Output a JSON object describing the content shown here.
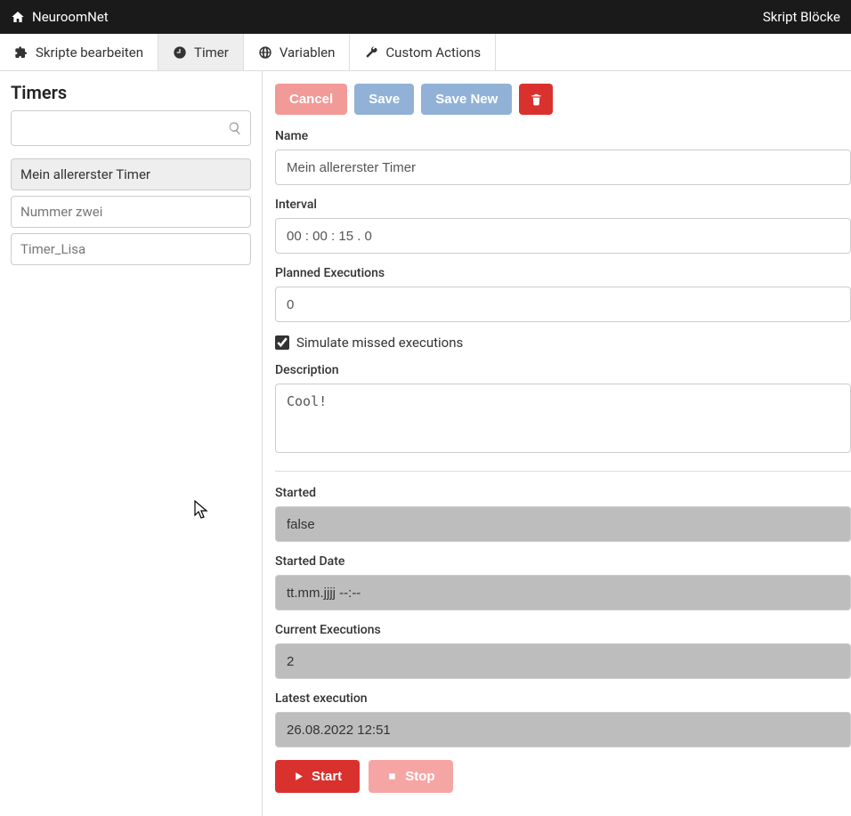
{
  "topbar": {
    "brand": "NeuroomNet",
    "right": "Skript Blöcke"
  },
  "tabs": [
    {
      "label": "Skripte bearbeiten",
      "icon": "puzzle"
    },
    {
      "label": "Timer",
      "icon": "clock",
      "active": true
    },
    {
      "label": "Variablen",
      "icon": "globe"
    },
    {
      "label": "Custom Actions",
      "icon": "wrench"
    }
  ],
  "sidebar": {
    "heading": "Timers",
    "search_value": "",
    "items": [
      {
        "label": "Mein allererster Timer",
        "active": true
      },
      {
        "label": "Nummer zwei"
      },
      {
        "label": "Timer_Lisa"
      }
    ]
  },
  "buttons": {
    "cancel": "Cancel",
    "save": "Save",
    "save_new": "Save New"
  },
  "form": {
    "name_label": "Name",
    "name_value": "Mein allererster Timer",
    "interval_label": "Interval",
    "interval_value": "00 : 00 : 15 . 0",
    "planned_label": "Planned Executions",
    "planned_value": "0",
    "simulate_label": "Simulate missed executions",
    "simulate_checked": true,
    "description_label": "Description",
    "description_value": "Cool!",
    "started_label": "Started",
    "started_value": "false",
    "started_date_label": "Started Date",
    "started_date_value": "tt.mm.jjjj --:--",
    "current_exec_label": "Current Executions",
    "current_exec_value": "2",
    "latest_exec_label": "Latest execution",
    "latest_exec_value": "26.08.2022 12:51"
  },
  "action": {
    "start": "Start",
    "stop": "Stop"
  }
}
